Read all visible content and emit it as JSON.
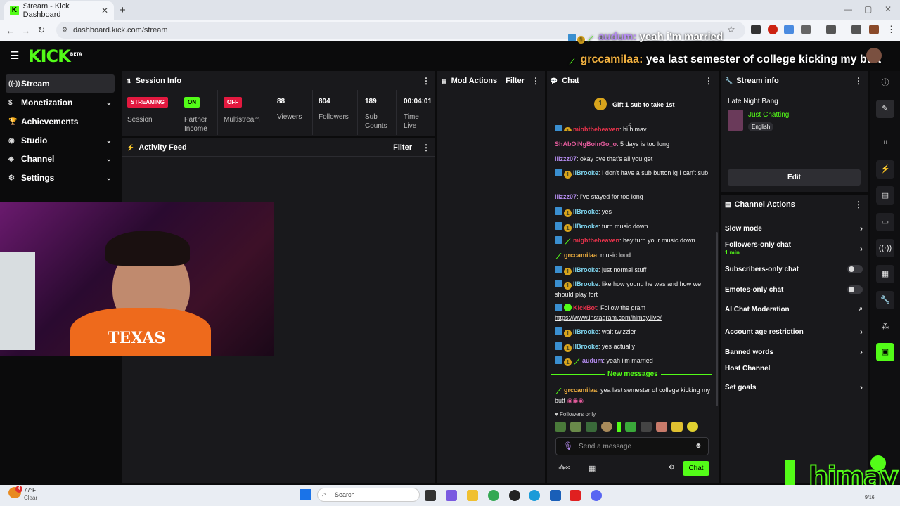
{
  "browser": {
    "tab_title": "Stream - Kick Dashboard",
    "url": "dashboard.kick.com/stream"
  },
  "logo": {
    "text": "KICK",
    "beta": "BETA"
  },
  "sidebar": {
    "items": [
      {
        "label": "Stream"
      },
      {
        "label": "Monetization"
      },
      {
        "label": "Achievements"
      },
      {
        "label": "Studio"
      },
      {
        "label": "Channel"
      },
      {
        "label": "Settings"
      }
    ]
  },
  "overlay": {
    "line1_user": "audum:",
    "line1_text": "yeah i'm married",
    "line2_user": "grccamilaa:",
    "line2_text": "yea last semester of college kicking my butt",
    "brand": "himay"
  },
  "session": {
    "title": "Session Info",
    "streaming_badge": "STREAMING",
    "session_label": "Session",
    "on_badge": "ON",
    "partner_label": "Partner Income",
    "off_badge": "OFF",
    "multistream_label": "Multistream",
    "viewers": "88",
    "viewers_label": "Viewers",
    "followers": "804",
    "followers_label": "Followers",
    "subs": "189",
    "subs_label": "Sub Counts",
    "time": "00:04:01",
    "time_label": "Time Live"
  },
  "activity": {
    "title": "Activity Feed",
    "filter": "Filter"
  },
  "mod": {
    "title": "Mod Actions",
    "filter": "Filter"
  },
  "chat": {
    "title": "Chat",
    "gift_count": "1",
    "gift_text": "Gift 1 sub to take 1st",
    "messages": [
      {
        "user": "mightbeheaven",
        "text": "hi himay",
        "color": "#e8324b"
      },
      {
        "user": "ShAbOiNgBoinGo_o",
        "text": "5 days is too long",
        "color": "#e05a9a"
      },
      {
        "user": "liizzz07",
        "text": "okay bye that's all you get",
        "color": "#b58cf0"
      },
      {
        "user": "IlBrooke",
        "text": "I don't have a sub button ig I can't sub",
        "color": "#7fd6f0"
      },
      {
        "user": "liizzz07",
        "text": "i've stayed for too long",
        "color": "#b58cf0"
      },
      {
        "user": "IlBrooke",
        "text": "yes",
        "color": "#7fd6f0"
      },
      {
        "user": "IlBrooke",
        "text": "turn music down",
        "color": "#7fd6f0"
      },
      {
        "user": "mightbeheaven",
        "text": "hey turn your music down",
        "color": "#e8324b"
      },
      {
        "user": "grccamilaa",
        "text": "music loud",
        "color": "#f0b040"
      },
      {
        "user": "IlBrooke",
        "text": "just normal stuff",
        "color": "#7fd6f0"
      },
      {
        "user": "IlBrooke",
        "text": "like how young he was and how we should play fort",
        "color": "#7fd6f0"
      },
      {
        "user": "KickBot",
        "text": "Follow the gram",
        "link": "https://www.instagram.com/himay.live/",
        "color": "#e8324b"
      },
      {
        "user": "IlBrooke",
        "text": "wait twizzler",
        "color": "#7fd6f0"
      },
      {
        "user": "IlBrooke",
        "text": "yes actually",
        "color": "#7fd6f0"
      },
      {
        "user": "audum",
        "text": "yeah i'm married",
        "color": "#b58cf0"
      }
    ],
    "new_messages": "New messages",
    "new_msg": {
      "user": "grccamilaa",
      "text": "yea last semester of college kicking my butt",
      "color": "#f0b040"
    },
    "followers_only": "Followers only",
    "placeholder": "Send a message",
    "send": "Chat"
  },
  "stream_info": {
    "title": "Stream info",
    "stream_title": "Late Night Bang",
    "category": "Just Chatting",
    "language": "English",
    "edit": "Edit"
  },
  "channel_actions": {
    "title": "Channel Actions",
    "slow": "Slow mode",
    "followers": "Followers-only chat",
    "followers_sub": "1 min",
    "subscribers": "Subscribers-only chat",
    "emotes": "Emotes-only chat",
    "ai": "AI Chat Moderation",
    "account": "Account age restriction",
    "banned": "Banned words",
    "host": "Host Channel",
    "goals": "Set goals"
  },
  "taskbar": {
    "temp": "77°F",
    "weather": "Clear",
    "search": "Search",
    "notif": "4",
    "date": "9/16"
  }
}
